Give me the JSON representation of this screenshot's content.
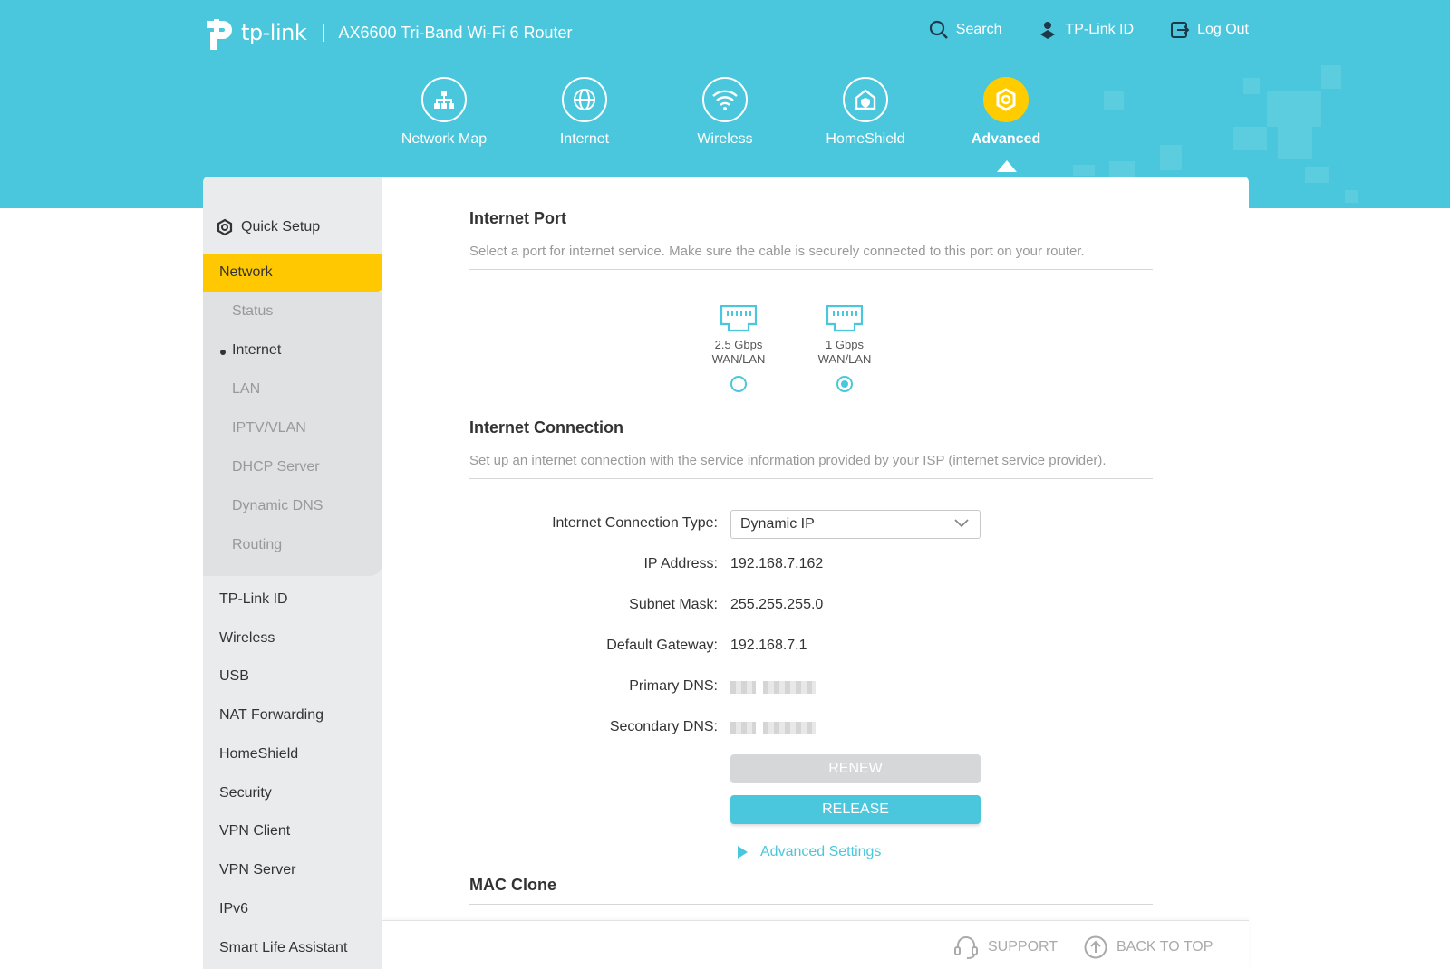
{
  "header": {
    "logo_text": "tp-link",
    "separator": "|",
    "model": "AX6600 Tri-Band Wi-Fi 6 Router",
    "links": {
      "search": "Search",
      "tplink_id": "TP-Link ID",
      "logout": "Log Out"
    }
  },
  "nav": {
    "items": [
      {
        "label": "Network Map",
        "icon": "network-map-icon"
      },
      {
        "label": "Internet",
        "icon": "globe-icon"
      },
      {
        "label": "Wireless",
        "icon": "wifi-icon"
      },
      {
        "label": "HomeShield",
        "icon": "home-shield-icon"
      },
      {
        "label": "Advanced",
        "icon": "gear-icon",
        "active": true
      }
    ]
  },
  "sidebar": {
    "quick_setup": "Quick Setup",
    "network": "Network",
    "network_sub": [
      "Status",
      "Internet",
      "LAN",
      "IPTV/VLAN",
      "DHCP Server",
      "Dynamic DNS",
      "Routing"
    ],
    "active_sub": "Internet",
    "items": [
      "TP-Link ID",
      "Wireless",
      "USB",
      "NAT Forwarding",
      "HomeShield",
      "Security",
      "VPN Client",
      "VPN Server",
      "IPv6",
      "Smart Life Assistant"
    ]
  },
  "internet_port": {
    "title": "Internet Port",
    "desc": "Select a port for internet service. Make sure the cable is securely connected to this port on your router.",
    "ports": [
      {
        "speed": "2.5 Gbps",
        "type": "WAN/LAN",
        "selected": false
      },
      {
        "speed": "1 Gbps",
        "type": "WAN/LAN",
        "selected": true
      }
    ]
  },
  "internet_connection": {
    "title": "Internet Connection",
    "desc": "Set up an internet connection with the service information provided by your ISP (internet service provider).",
    "type_label": "Internet Connection Type:",
    "type_value": "Dynamic IP",
    "ip_label": "IP Address:",
    "ip_value": "192.168.7.162",
    "mask_label": "Subnet Mask:",
    "mask_value": "255.255.255.0",
    "gateway_label": "Default Gateway:",
    "gateway_value": "192.168.7.1",
    "dns1_label": "Primary DNS:",
    "dns2_label": "Secondary DNS:",
    "renew": "RENEW",
    "release": "RELEASE",
    "advanced": "Advanced Settings"
  },
  "mac_clone": {
    "title": "MAC Clone"
  },
  "footer": {
    "support": "SUPPORT",
    "back_to_top": "BACK TO TOP"
  },
  "colors": {
    "accent": "#4ac7dc",
    "active": "#ffc800"
  }
}
